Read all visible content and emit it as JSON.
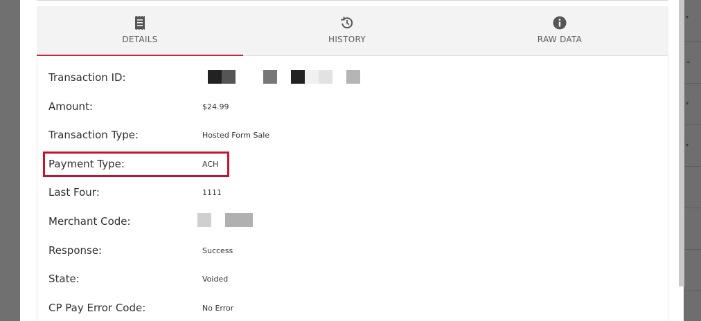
{
  "tabs": [
    {
      "label": "DETAILS",
      "icon": "receipt-icon",
      "active": true
    },
    {
      "label": "HISTORY",
      "icon": "history-icon",
      "active": false
    },
    {
      "label": "RAW DATA",
      "icon": "info-icon",
      "active": false
    }
  ],
  "details": [
    {
      "key": "Transaction ID:",
      "value": ""
    },
    {
      "key": "Amount:",
      "value": "$24.99"
    },
    {
      "key": "Transaction Type:",
      "value": "Hosted Form Sale"
    },
    {
      "key": "Payment Type:",
      "value": "ACH"
    },
    {
      "key": "Last Four:",
      "value": "1111"
    },
    {
      "key": "Merchant Code:",
      "value": ""
    },
    {
      "key": "Response:",
      "value": "Success"
    },
    {
      "key": "State:",
      "value": "Voided"
    },
    {
      "key": "CP Pay Error Code:",
      "value": "No Error"
    }
  ],
  "colors": {
    "accent": "#c0273a",
    "highlight": "#c4122f",
    "tab_bg": "#f3f3f3"
  }
}
